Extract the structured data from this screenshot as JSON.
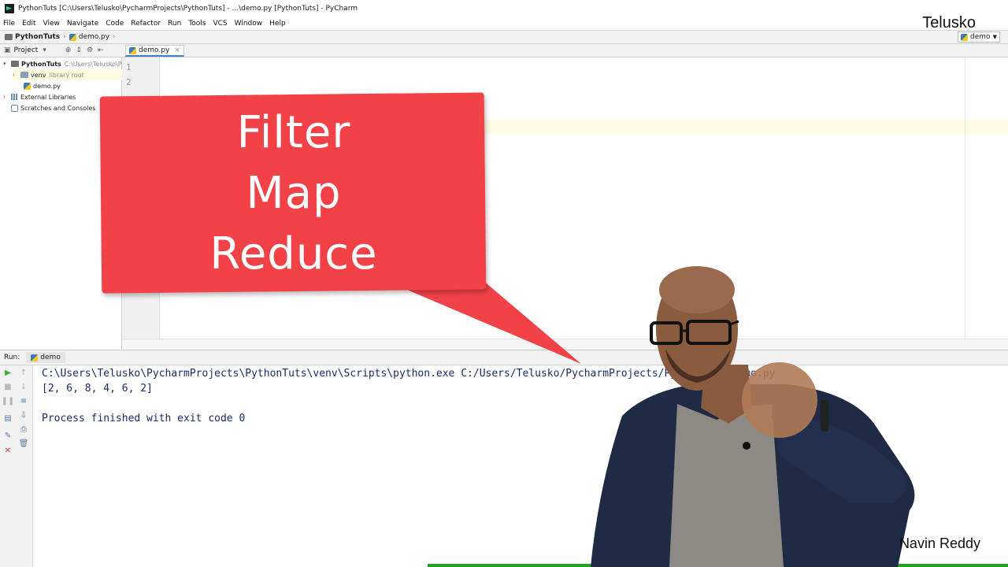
{
  "window": {
    "title": "PythonTuts [C:\\Users\\Telusko\\PycharmProjects\\PythonTuts] - ...\\demo.py [PythonTuts] - PyCharm"
  },
  "menu": [
    "File",
    "Edit",
    "View",
    "Navigate",
    "Code",
    "Refactor",
    "Run",
    "Tools",
    "VCS",
    "Window",
    "Help"
  ],
  "brand": "Telusko",
  "breadcrumb": {
    "project": "PythonTuts",
    "file": "demo.py"
  },
  "run_config": "demo",
  "project_panel": {
    "label": "Project",
    "tree": [
      {
        "label": "PythonTuts",
        "hint": "C:\\Users\\Telusko\\Py"
      },
      {
        "label": "venv",
        "hint": "library root"
      },
      {
        "label": "demo.py",
        "hint": ""
      },
      {
        "label": "External Libraries",
        "hint": ""
      },
      {
        "label": "Scratches and Consoles",
        "hint": ""
      }
    ]
  },
  "editor": {
    "tab": "demo.py",
    "line_numbers": [
      "1",
      "2"
    ]
  },
  "run_panel": {
    "label": "Run:",
    "tab": "demo",
    "output": [
      "C:\\Users\\Telusko\\PycharmProjects\\PythonTuts\\venv\\Scripts\\python.exe C:/Users/Telusko/PycharmProjects/PythonTuts/demo.py",
      "[2, 6, 8, 4, 6, 2]",
      "",
      "Process finished with exit code 0"
    ]
  },
  "callout": {
    "lines": [
      "Filter",
      "Map",
      "Reduce"
    ],
    "color": "#f24248"
  },
  "presenter_caption": "Navin Reddy"
}
